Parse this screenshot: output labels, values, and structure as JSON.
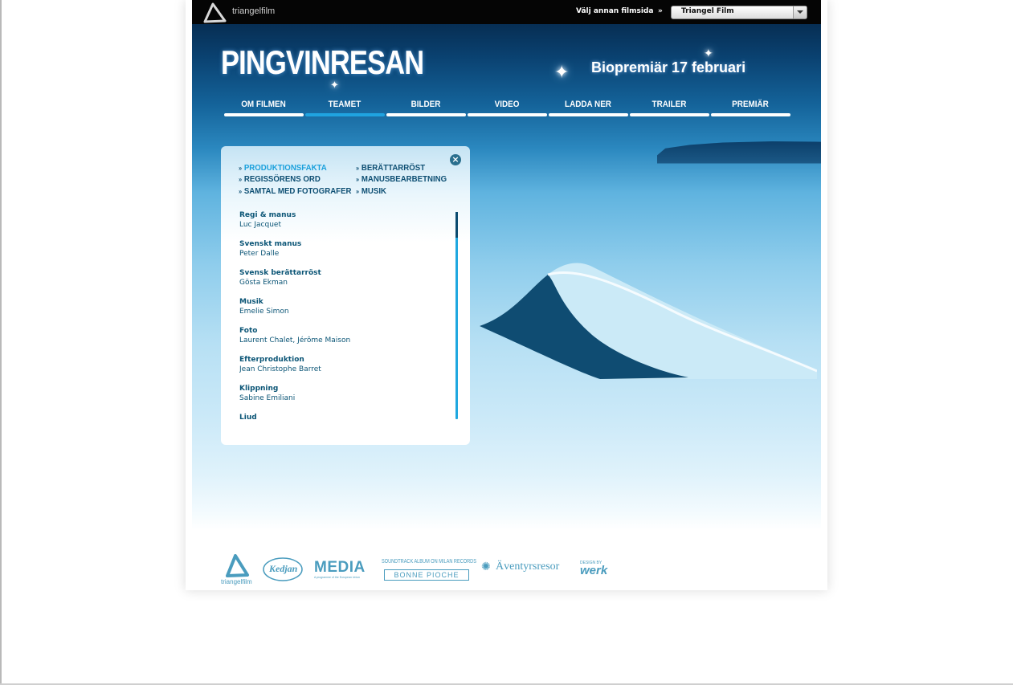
{
  "topbar": {
    "logo_text": "triangelfilm",
    "choose_label": "Välj annan filmsida",
    "choose_arrows": "»",
    "select_value": "Triangel Film"
  },
  "header": {
    "title": "PINGVINRESAN",
    "premiere": "Biopremiär 17 februari"
  },
  "nav": [
    {
      "label": "OM FILMEN",
      "active": false
    },
    {
      "label": "TEAMET",
      "active": true
    },
    {
      "label": "BILDER",
      "active": false
    },
    {
      "label": "VIDEO",
      "active": false
    },
    {
      "label": "LADDA NER",
      "active": false
    },
    {
      "label": "TRAILER",
      "active": false
    },
    {
      "label": "PREMIÄR",
      "active": false
    }
  ],
  "panel": {
    "close_icon": "×",
    "submenu": {
      "col1": [
        "PRODUKTIONSFAKTA",
        "REGISSÖRENS ORD",
        "SAMTAL MED FOTOGRAFER"
      ],
      "col2": [
        "BERÄTTARRÖST",
        "MANUSBEARBETNING",
        "MUSIK"
      ],
      "active": "PRODUKTIONSFAKTA",
      "arrow": "»"
    },
    "credits": [
      {
        "role": "Regi & manus",
        "name": "Luc Jacquet"
      },
      {
        "role": "Svenskt manus",
        "name": "Peter Dalle"
      },
      {
        "role": "Svensk berättarröst",
        "name": "Gösta Ekman"
      },
      {
        "role": "Musik",
        "name": "Emelie Simon"
      },
      {
        "role": "Foto",
        "name": "Laurent Chalet, Jérôme Maison"
      },
      {
        "role": "Efterproduktion",
        "name": "Jean Christophe Barret"
      },
      {
        "role": "Klippning",
        "name": "Sabine Emiliani"
      },
      {
        "role": "Ljud",
        "name": ""
      }
    ]
  },
  "footer": {
    "logo_triangelfilm": "triangelfilm",
    "logo_kedjan": "Kedjan",
    "logo_media": "MEDIA",
    "logo_media_sub": "A programme of the European Union",
    "logo_soundtrack": "SOUNDTRACK ALBUM ON MILAN RECORDS",
    "logo_bonnepioche": "BONNE PIOCHE",
    "logo_aventyrsresor": "Äventyrsresor",
    "logo_design_by": "DESIGN BY",
    "logo_werk": "werk"
  },
  "colors": {
    "accent": "#1fa3e0",
    "panel_text": "#0b5576",
    "logo_blue": "#4a9cbe"
  }
}
